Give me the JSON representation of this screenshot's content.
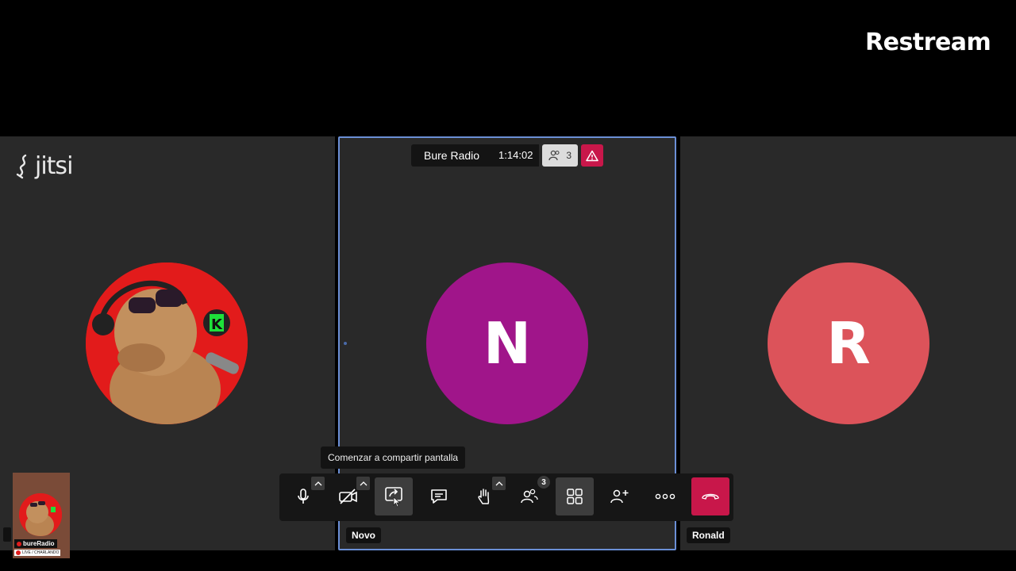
{
  "brand": {
    "name": "Restream"
  },
  "jitsi": {
    "logo_text": "jitsi"
  },
  "conference": {
    "name": "Bure Radio",
    "duration": "1:14:02",
    "participant_count": "3"
  },
  "participants": [
    {
      "initial": "",
      "label": "",
      "avatar_type": "image",
      "avatar_color": "#e21b1b"
    },
    {
      "initial": "N",
      "label": "Novo",
      "avatar_color": "#a0158a"
    },
    {
      "initial": "R",
      "label": "Ronald",
      "avatar_color": "#dc535a"
    }
  ],
  "tooltip": {
    "text": "Comenzar a compartir pantalla"
  },
  "toolbar": {
    "items": [
      {
        "name": "microphone",
        "icon": "microphone-icon"
      },
      {
        "name": "camera",
        "icon": "camera-off-icon"
      },
      {
        "name": "share-screen",
        "icon": "share-screen-icon",
        "active": true
      },
      {
        "name": "chat",
        "icon": "chat-icon"
      },
      {
        "name": "raise-hand",
        "icon": "hand-icon"
      },
      {
        "name": "participants",
        "icon": "participants-icon",
        "badge": "3"
      },
      {
        "name": "tile-view",
        "icon": "grid-icon",
        "active": true
      },
      {
        "name": "invite",
        "icon": "add-person-icon"
      },
      {
        "name": "more",
        "icon": "more-icon"
      },
      {
        "name": "hangup",
        "icon": "hangup-icon",
        "color": "#c8174a"
      }
    ]
  },
  "overlay": {
    "channel_name": "bureRadio",
    "live_text": "LIVE / CHARLANDO"
  },
  "colors": {
    "active_border": "#6b8fd6",
    "alert": "#c8174a",
    "tile_bg": "#292929"
  }
}
